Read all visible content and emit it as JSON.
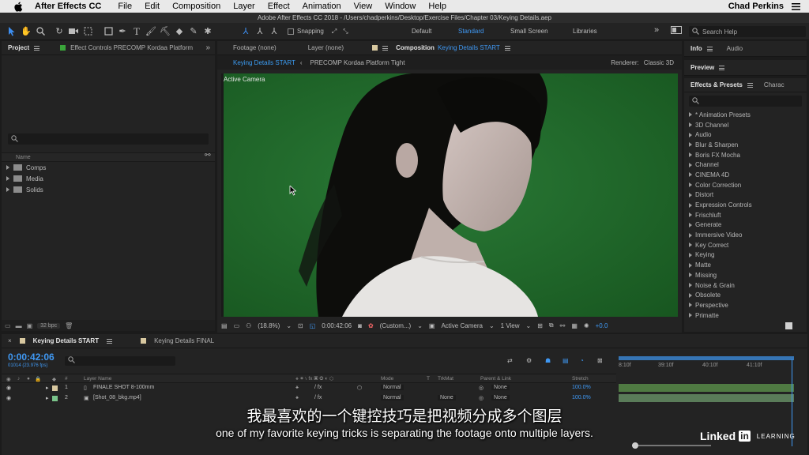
{
  "menubar": {
    "app": "After Effects CC",
    "items": [
      "File",
      "Edit",
      "Composition",
      "Layer",
      "Effect",
      "Animation",
      "View",
      "Window",
      "Help"
    ],
    "user": "Chad Perkins"
  },
  "titlebar": {
    "title": "Adobe After Effects CC 2018 - /Users/chadperkins/Desktop/Exercise Files/Chapter 03/Keying Details.aep"
  },
  "toolbar": {
    "snapping": "Snapping",
    "workspaces": [
      "Default",
      "Standard",
      "Small Screen",
      "Libraries"
    ],
    "search_placeholder": "Search Help"
  },
  "project": {
    "tab": "Project",
    "effect_controls": "Effect Controls PRECOMP Kordaa Platform",
    "column_name": "Name",
    "folders": [
      "Comps",
      "Media",
      "Solids"
    ],
    "bpc": "32 bpc"
  },
  "comp": {
    "tabs": {
      "footage": "Footage (none)",
      "layer": "Layer (none)",
      "composition_prefix": "Composition",
      "composition_name": "Keying Details START"
    },
    "flow": {
      "current": "Keying Details START",
      "other": "PRECOMP Kordaa Platform Tight"
    },
    "renderer_label": "Renderer:",
    "renderer_value": "Classic 3D",
    "viewer_label": "Active Camera",
    "bar": {
      "zoom": "(18.8%)",
      "timecode": "0:00:42:06",
      "resolution": "(Custom...)",
      "view": "Active Camera",
      "views": "1 View",
      "exposure": "+0.0"
    }
  },
  "right": {
    "info_tab": "Info",
    "audio_tab": "Audio",
    "preview_tab": "Preview",
    "effects_tab": "Effects & Presets",
    "charac_tab": "Charac",
    "effects": [
      "* Animation Presets",
      "3D Channel",
      "Audio",
      "Blur & Sharpen",
      "Boris FX Mocha",
      "Channel",
      "CINEMA 4D",
      "Color Correction",
      "Distort",
      "Expression Controls",
      "Frischluft",
      "Generate",
      "Immersive Video",
      "Key Correct",
      "Keying",
      "Matte",
      "Missing",
      "Noise & Grain",
      "Obsolete",
      "Perspective",
      "Primatte"
    ]
  },
  "timeline": {
    "tabs": [
      "Keying Details START",
      "Keying Details FINAL"
    ],
    "timecode": "0:00:42:06",
    "fps": "01014 (23.976 fps)",
    "columns": {
      "hash": "#",
      "layer_name": "Layer Name",
      "mode": "Mode",
      "t": "T",
      "trkmat": "TrkMat",
      "parent": "Parent & Link",
      "stretch": "Stretch"
    },
    "layers": [
      {
        "num": "1",
        "name": "FINALE SHOT 8-100mm",
        "mode": "Normal",
        "trkmat": "",
        "parent": "None",
        "stretch": "100.0%"
      },
      {
        "num": "2",
        "name": "[Shot_08_bkg.mp4]",
        "mode": "Normal",
        "trkmat": "None",
        "parent": "None",
        "stretch": "100.0%"
      }
    ],
    "ruler": [
      "8:10f",
      "39:10f",
      "40:10f",
      "41:10f"
    ]
  },
  "subtitles": {
    "zh": "我最喜欢的一个键控技巧是把视频分成多个图层",
    "en": "one of my favorite keying tricks is separating the footage onto multiple layers."
  },
  "watermark": {
    "linked": "Linked",
    "in": "in",
    "learning": "LEARNING"
  },
  "colors": {
    "accent": "#3f98f3",
    "green_screen": "#1f6b2c",
    "track_green": "#4f7a42"
  }
}
